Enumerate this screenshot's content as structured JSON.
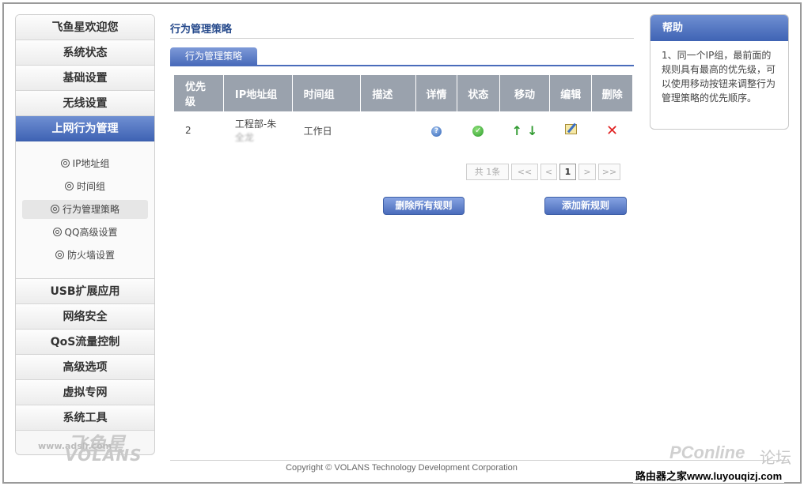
{
  "sidebar": {
    "top_items": [
      {
        "label": "飞鱼星欢迎您"
      },
      {
        "label": "系统状态"
      },
      {
        "label": "基础设置"
      },
      {
        "label": "无线设置"
      },
      {
        "label": "上网行为管理"
      }
    ],
    "sub_items": [
      {
        "label": "IP地址组"
      },
      {
        "label": "时间组"
      },
      {
        "label": "行为管理策略"
      },
      {
        "label": "QQ高级设置"
      },
      {
        "label": "防火墙设置"
      }
    ],
    "bottom_items": [
      {
        "label": "USB扩展应用"
      },
      {
        "label": "网络安全"
      },
      {
        "label": "QoS流量控制"
      },
      {
        "label": "高级选项"
      },
      {
        "label": "虚拟专网"
      },
      {
        "label": "系统工具"
      }
    ],
    "brand": {
      "cn": "飞鱼星",
      "url": "www.adslr.com",
      "en": "VOLANS"
    }
  },
  "main": {
    "page_title": "行为管理策略",
    "tab_label": "行为管理策略",
    "table": {
      "headers": [
        "优先级",
        "IP地址组",
        "时间组",
        "描述",
        "详情",
        "状态",
        "移动",
        "编辑",
        "删除"
      ],
      "header_priority_1": "优先",
      "header_priority_2": "级",
      "rows": [
        {
          "priority": "2",
          "ip_group": "工程部-朱",
          "ip_group_2": "全龙",
          "time_group": "工作日",
          "description": "",
          "details_icon": "info-icon",
          "status_icon": "check-icon",
          "status_color": "#2b9a2b"
        }
      ]
    },
    "pager": {
      "total": "共 1条",
      "first": "<<",
      "prev": "<",
      "current": "1",
      "next": ">",
      "last": ">>"
    },
    "buttons": {
      "delete_all": "删除所有规则",
      "add_new": "添加新规则"
    }
  },
  "help": {
    "title": "帮助",
    "text": "1、同一个IP组，最前面的规则具有最高的优先级，可以使用移动按钮来调整行为管理策略的优先顺序。"
  },
  "footer": {
    "copyright": "Copyright © VOLANS Technology Development Corporation"
  },
  "watermark": {
    "pconline": "PConline",
    "forum": "论坛",
    "site": "路由器之家www.luyouqizj.com"
  },
  "colors": {
    "accent": "#4a6cbb",
    "header_bg": "#9aa2ad",
    "delete": "#e02020"
  }
}
